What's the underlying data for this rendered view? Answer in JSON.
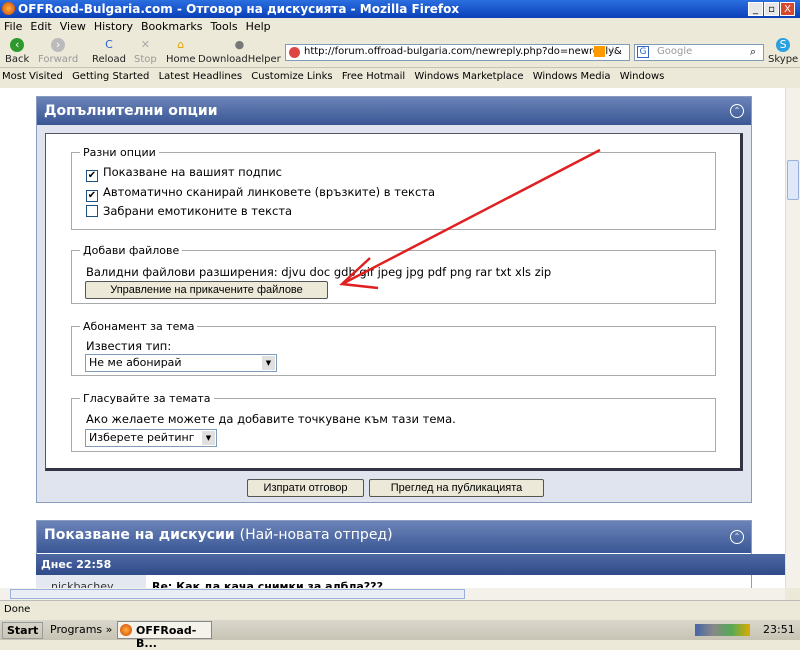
{
  "window": {
    "title": "OFFRoad-Bulgaria.com - Отговор на дискусията - Mozilla Firefox"
  },
  "menu": [
    "File",
    "Edit",
    "View",
    "History",
    "Bookmarks",
    "Tools",
    "Help"
  ],
  "nav": {
    "back": "Back",
    "forward": "Forward",
    "reload": "Reload",
    "stop": "Stop",
    "home": "Home",
    "downloadhelper": "DownloadHelper",
    "skype": "Skype"
  },
  "url": "http://forum.offroad-bulgaria.com/newreply.php?do=newreply&",
  "search_placeholder": "Google",
  "bookmarks": [
    "Most Visited",
    "Getting Started",
    "Latest Headlines",
    "Customize Links",
    "Free Hotmail",
    "Windows Marketplace",
    "Windows Media",
    "Windows"
  ],
  "options": {
    "title": "Допълнителни опции",
    "misc": {
      "legend": "Разни опции",
      "items": [
        {
          "label": "Показване на вашият подпис",
          "checked": true
        },
        {
          "label": "Автоматично сканирай линковете (връзките) в текста",
          "checked": true
        },
        {
          "label": "Забрани емотиконите в текста",
          "checked": false
        }
      ]
    },
    "attach": {
      "legend": "Добави файлове",
      "valid": "Валидни файлови разширения: djvu doc gdb gif jpeg jpg pdf png rar txt xls zip",
      "button": "Управление на прикачените файлове"
    },
    "subscribe": {
      "legend": "Абонамент за тема",
      "label": "Известия тип:",
      "value": "Не ме абонирай"
    },
    "rate": {
      "legend": "Гласувайте за темата",
      "label": "Ако желаете можете да добавите точкуване към тази тема.",
      "value": "Изберете рейтинг"
    }
  },
  "buttons": {
    "submit": "Изпрати отговор",
    "preview": "Преглед на публикацията"
  },
  "thread": {
    "title": "Показване на дискусии",
    "subtitle": "(Най-новата отпред)",
    "date": "Днес 22:58",
    "user": "nickbachev",
    "post_title": "Re: Как да кача снимки за албла???"
  },
  "status": "Done",
  "taskbar": {
    "start": "Start",
    "programs": "Programs",
    "task": "OFFRoad-B...",
    "clock": "23:51"
  },
  "colors": {
    "header": "#3a5795",
    "arrow": "#e02020"
  }
}
